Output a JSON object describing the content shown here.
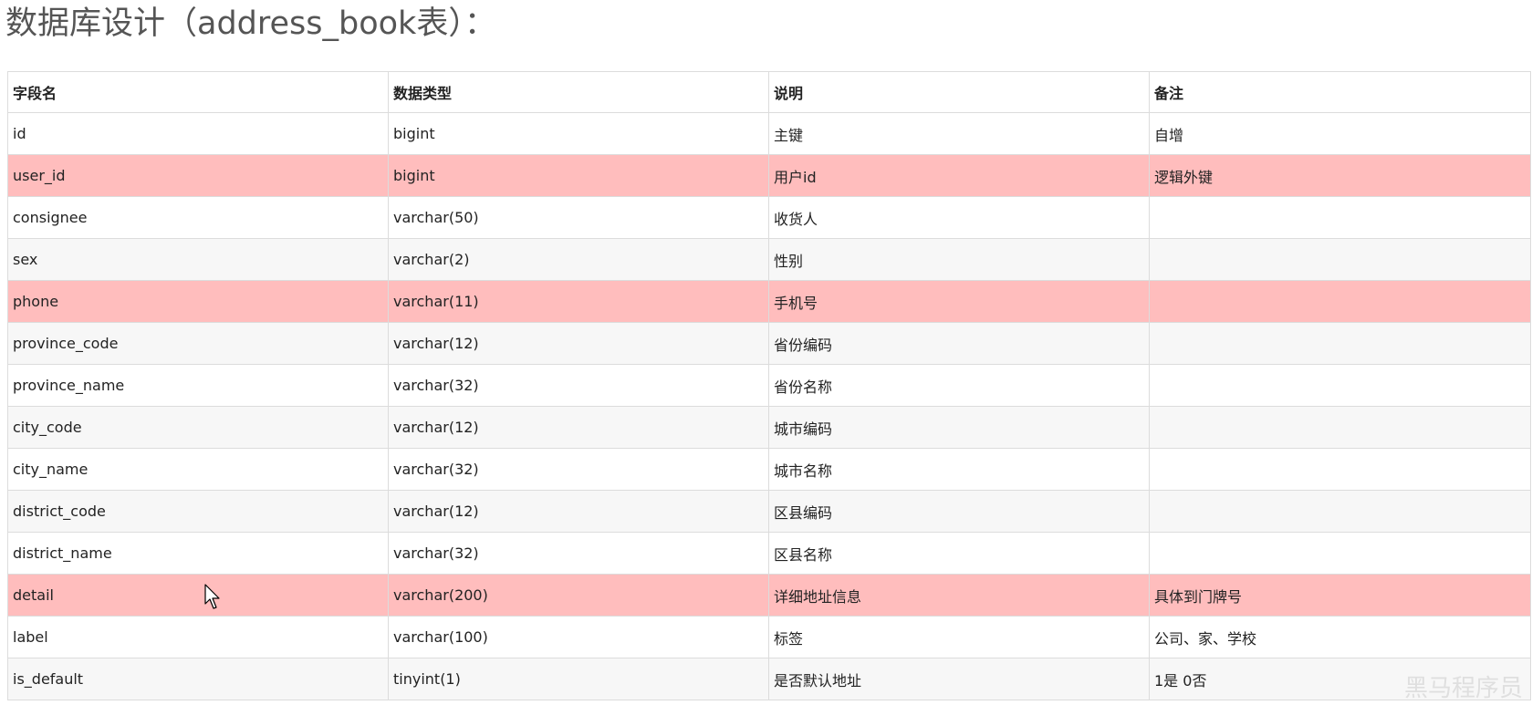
{
  "title": "数据库设计（address_book表）：",
  "table": {
    "headers": [
      "字段名",
      "数据类型",
      "说明",
      "备注"
    ],
    "rows": [
      {
        "field": "id",
        "type": "bigint",
        "desc": "主键",
        "note": "自增",
        "highlight": false
      },
      {
        "field": "user_id",
        "type": "bigint",
        "desc": "用户id",
        "note": "逻辑外键",
        "highlight": true
      },
      {
        "field": "consignee",
        "type": "varchar(50)",
        "desc": "收货人",
        "note": "",
        "highlight": false
      },
      {
        "field": "sex",
        "type": "varchar(2)",
        "desc": "性别",
        "note": "",
        "highlight": false
      },
      {
        "field": "phone",
        "type": "varchar(11)",
        "desc": "手机号",
        "note": "",
        "highlight": true
      },
      {
        "field": "province_code",
        "type": "varchar(12)",
        "desc": "省份编码",
        "note": "",
        "highlight": false
      },
      {
        "field": "province_name",
        "type": "varchar(32)",
        "desc": "省份名称",
        "note": "",
        "highlight": false
      },
      {
        "field": "city_code",
        "type": "varchar(12)",
        "desc": "城市编码",
        "note": "",
        "highlight": false
      },
      {
        "field": "city_name",
        "type": "varchar(32)",
        "desc": "城市名称",
        "note": "",
        "highlight": false
      },
      {
        "field": "district_code",
        "type": "varchar(12)",
        "desc": "区县编码",
        "note": "",
        "highlight": false
      },
      {
        "field": "district_name",
        "type": "varchar(32)",
        "desc": "区县名称",
        "note": "",
        "highlight": false
      },
      {
        "field": "detail",
        "type": "varchar(200)",
        "desc": "详细地址信息",
        "note": "具体到门牌号",
        "highlight": true
      },
      {
        "field": "label",
        "type": "varchar(100)",
        "desc": "标签",
        "note": "公司、家、学校",
        "highlight": false
      },
      {
        "field": "is_default",
        "type": "tinyint(1)",
        "desc": "是否默认地址",
        "note": "1是 0否",
        "highlight": false
      }
    ]
  },
  "colors": {
    "highlight_row": "#ffbdbd",
    "zebra_row": "#f7f7f7",
    "border": "#dcdcdc"
  },
  "watermark": "黑马程序员"
}
